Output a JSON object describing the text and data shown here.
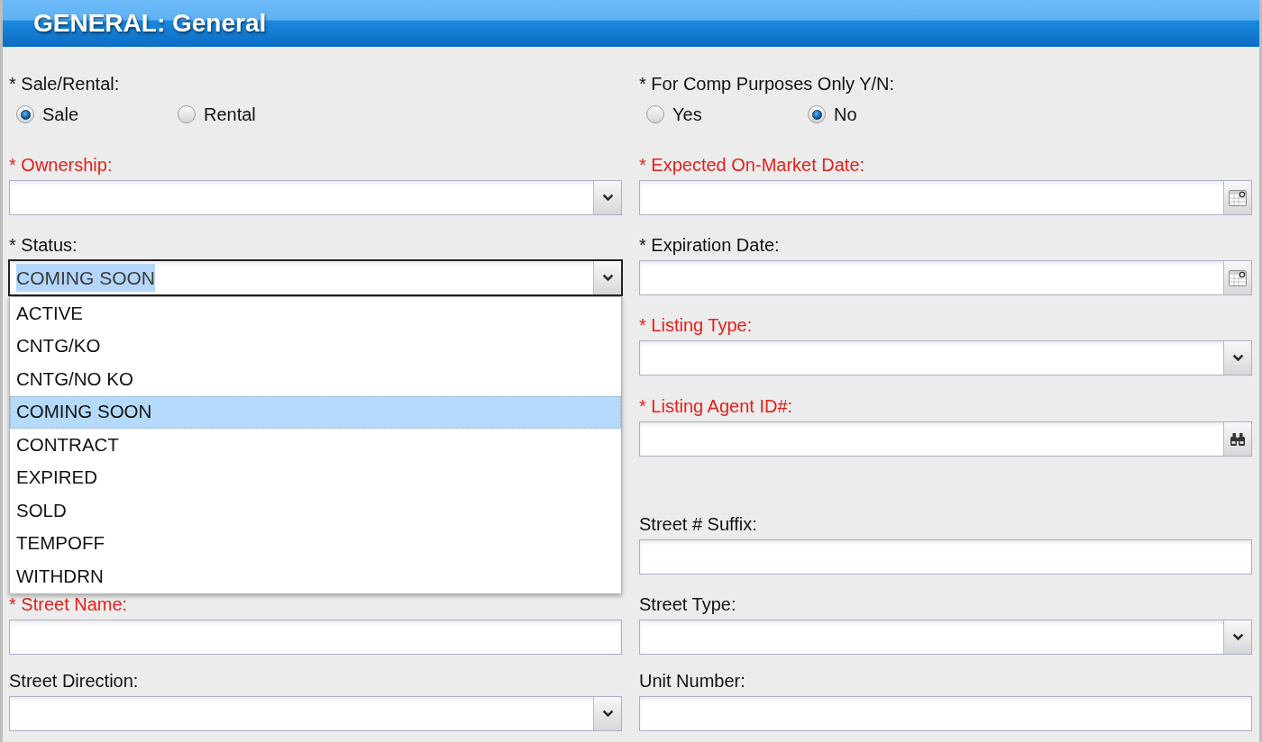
{
  "section": {
    "title": "GENERAL: General"
  },
  "rows": [
    {
      "left": {
        "kind": "radio",
        "label": "* Sale/Rental:",
        "error": false,
        "options": [
          {
            "label": "Sale",
            "selected": true
          },
          {
            "label": "Rental",
            "selected": false
          }
        ]
      },
      "right": {
        "kind": "radio",
        "label": "* For Comp Purposes Only Y/N:",
        "error": false,
        "options": [
          {
            "label": "Yes",
            "selected": false
          },
          {
            "label": "No",
            "selected": true
          }
        ]
      }
    },
    {
      "left": {
        "kind": "select",
        "label": "* Ownership:",
        "error": true,
        "expanded": false
      },
      "right": {
        "kind": "date",
        "label": "* Expected On-Market Date:",
        "error": true
      }
    },
    {
      "left": {
        "kind": "select",
        "label": "* Status:",
        "error": false,
        "expanded": true,
        "value": "COMING SOON",
        "options": [
          {
            "label": "ACTIVE",
            "selected": false
          },
          {
            "label": "CNTG/KO",
            "selected": false
          },
          {
            "label": "CNTG/NO KO",
            "selected": false
          },
          {
            "label": "COMING SOON",
            "selected": true
          },
          {
            "label": "CONTRACT",
            "selected": false
          },
          {
            "label": "EXPIRED",
            "selected": false
          },
          {
            "label": "SOLD",
            "selected": false
          },
          {
            "label": "TEMPOFF",
            "selected": false
          },
          {
            "label": "WITHDRN",
            "selected": false
          }
        ]
      },
      "right": {
        "kind": "date",
        "label": "* Expiration Date:",
        "error": false
      }
    },
    {
      "right": {
        "kind": "select",
        "label": "* Listing Type:",
        "error": true,
        "expanded": false
      }
    },
    {
      "right": {
        "kind": "lookup",
        "label": "* Listing Agent ID#:",
        "error": true
      }
    },
    {
      "right": {
        "kind": "text",
        "label": "Street # Suffix:",
        "error": false
      }
    },
    {
      "left": {
        "kind": "text",
        "label": "* Street Name:",
        "error": true
      },
      "right": {
        "kind": "select",
        "label": "Street Type:",
        "error": false,
        "expanded": false
      }
    },
    {
      "left": {
        "kind": "select",
        "label": "Street Direction:",
        "error": false,
        "expanded": false
      },
      "right": {
        "kind": "text",
        "label": "Unit Number:",
        "error": false
      }
    }
  ]
}
